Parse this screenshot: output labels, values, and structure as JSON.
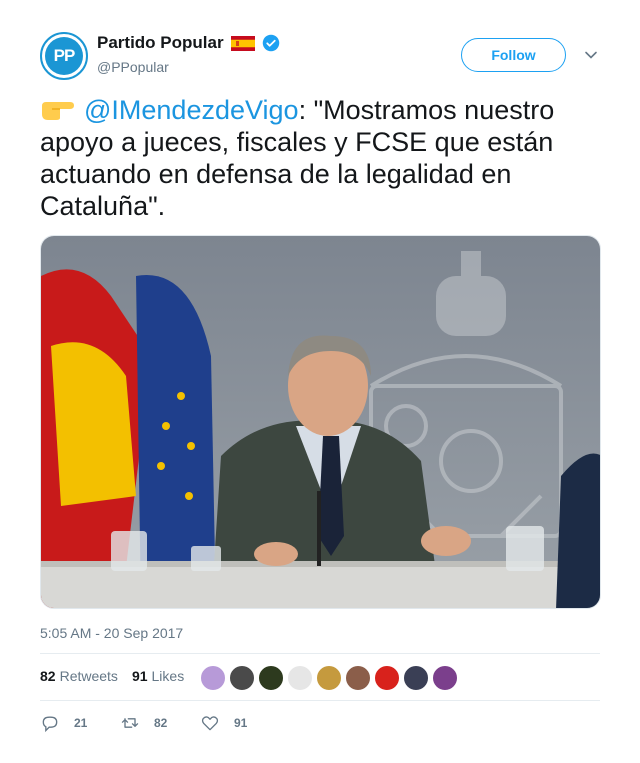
{
  "account": {
    "display_name": "Partido Popular",
    "handle": "@PPopular",
    "avatar_text": "PP",
    "verified": true,
    "brand_color": "#1b96d4"
  },
  "follow_label": "Follow",
  "tweet": {
    "emoji_icon": "backhand-index-pointing-right-icon",
    "mention": "@IMendezdeVigo",
    "text": ": \"Mostramos nuestro apoyo a jueces, fiscales y FCSE que están actuando en defensa de la legalidad en Cataluña\"."
  },
  "timestamp": "5:05 AM - 20 Sep 2017",
  "stats": {
    "retweets_count": "82",
    "retweets_label": "Retweets",
    "likes_count": "91",
    "likes_label": "Likes"
  },
  "liker_avatar_colors": [
    "#b79ad8",
    "#4a4a4a",
    "#2d3a1e",
    "#e6e6e6",
    "#c59a3e",
    "#8b5e4a",
    "#d8221c",
    "#3a3f55",
    "#7b3f8c"
  ],
  "actions": {
    "reply_count": "21",
    "retweet_count": "82",
    "like_count": "91"
  },
  "colors": {
    "accent": "#1da1f2",
    "mention": "#1b95e0",
    "muted": "#657786"
  }
}
